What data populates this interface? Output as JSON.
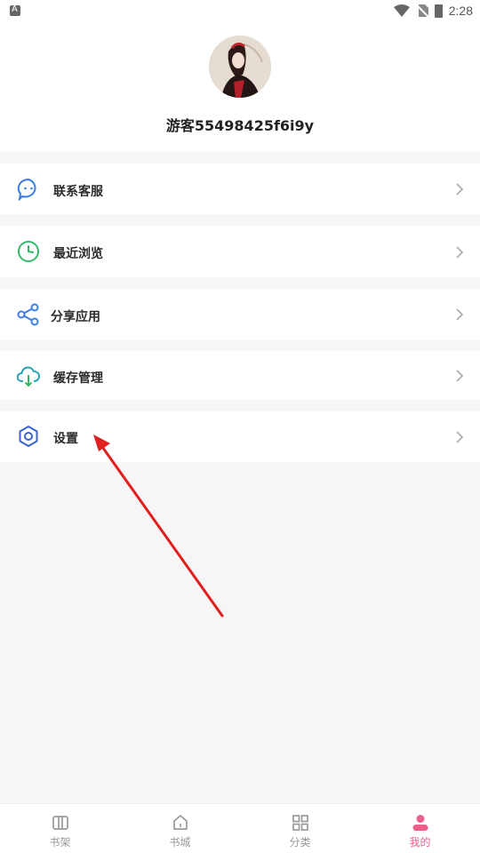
{
  "status_bar": {
    "time": "2:28"
  },
  "profile": {
    "username": "游客55498425f6i9y"
  },
  "menu": [
    {
      "label": "联系客服",
      "icon": "chat-bubble-icon"
    },
    {
      "label": "最近浏览",
      "icon": "clock-icon"
    },
    {
      "label": "分享应用",
      "icon": "share-icon"
    },
    {
      "label": "缓存管理",
      "icon": "cloud-download-icon"
    },
    {
      "label": "设置",
      "icon": "gear-icon"
    }
  ],
  "tabs": [
    {
      "label": "书架",
      "icon": "bookshelf-icon"
    },
    {
      "label": "书城",
      "icon": "home-icon"
    },
    {
      "label": "分类",
      "icon": "grid-icon"
    },
    {
      "label": "我的",
      "icon": "user-icon",
      "active": true
    }
  ],
  "colors": {
    "accent": "#ef5f8c",
    "menu_icon_blue": "#3b7fe6",
    "menu_icon_green": "#35b86a",
    "annotation_arrow": "#e01f1f"
  }
}
